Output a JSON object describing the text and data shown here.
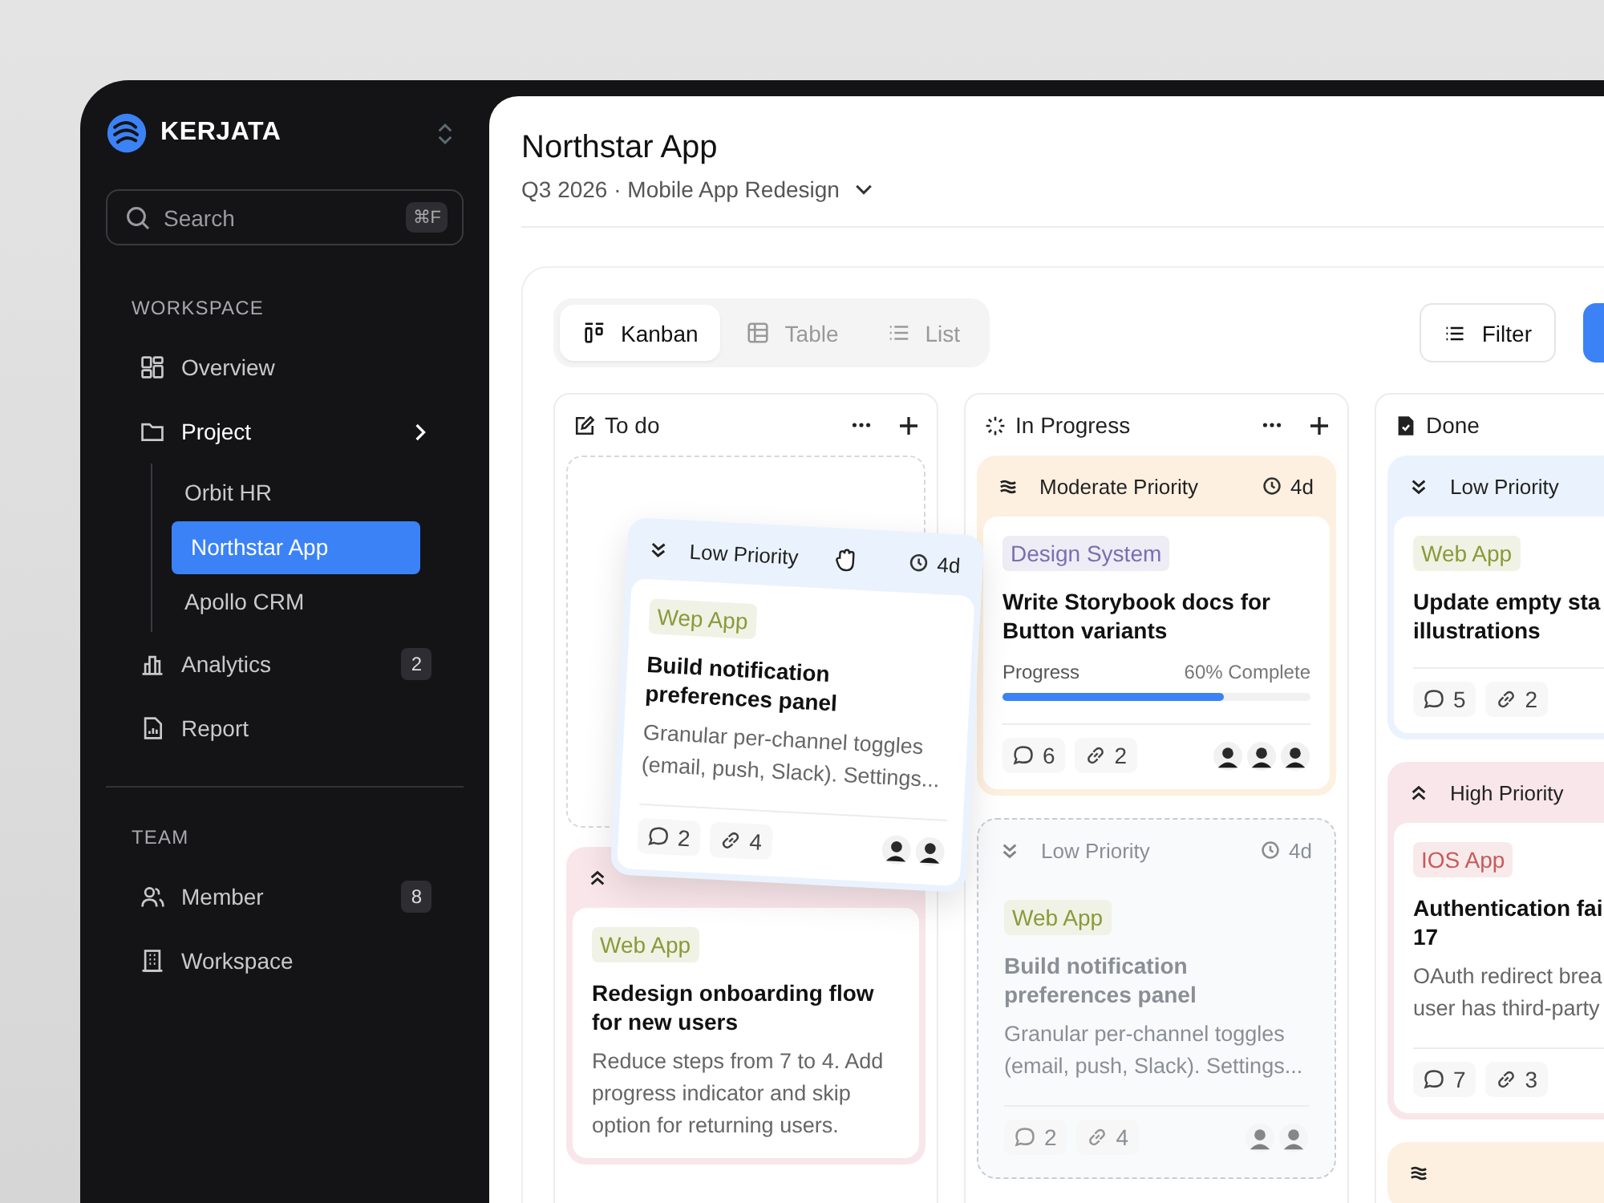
{
  "brand": {
    "name": "KERJATA"
  },
  "search": {
    "placeholder": "Search",
    "shortcut": "⌘F"
  },
  "sidebar": {
    "sections": [
      {
        "title": "WORKSPACE",
        "items": [
          {
            "label": "Overview",
            "selected": false
          },
          {
            "label": "Project",
            "selected": false,
            "children": [
              {
                "label": "Orbit HR",
                "selected": false
              },
              {
                "label": "Northstar App",
                "selected": true
              },
              {
                "label": "Apollo CRM",
                "selected": false
              }
            ]
          },
          {
            "label": "Analytics",
            "selected": false,
            "badge": "2"
          },
          {
            "label": "Report",
            "selected": false
          }
        ]
      },
      {
        "title": "TEAM",
        "items": [
          {
            "label": "Member",
            "selected": false,
            "badge": "8"
          },
          {
            "label": "Workspace",
            "selected": false
          }
        ]
      }
    ]
  },
  "header": {
    "title": "Northstar App",
    "subtitle": "Q3 2026 · Mobile App Redesign"
  },
  "view_tabs": [
    {
      "label": "Kanban",
      "selected": true
    },
    {
      "label": "Table",
      "selected": false
    },
    {
      "label": "List",
      "selected": false
    }
  ],
  "filter_button": {
    "label": "Filter"
  },
  "columns": [
    {
      "title": "To do",
      "cards": [
        {
          "kind": "placeholder"
        },
        {
          "kind": "low",
          "color": "#eaf3fd",
          "dragging": true,
          "ghost": false,
          "priority": "Low Priority",
          "due": "4d",
          "tag": {
            "label": "Wep App",
            "color": "#8a9a3a"
          },
          "title": "Build notification preferences panel",
          "description": "Granular per-channel toggles (email, push, Slack). Settings...",
          "comments": "2",
          "links": "4",
          "avatars": [
            {
              "kind": "person"
            },
            {
              "kind": "person"
            }
          ]
        },
        {
          "kind": "high",
          "color": "#f9e6ea",
          "dragging": false,
          "ghost": false,
          "tag": {
            "label": "Web App",
            "color": "#8a9a3a"
          },
          "title": "Redesign onboarding flow for new users",
          "description": "Reduce steps from 7 to 4. Add progress indicator and skip option for returning users."
        }
      ]
    },
    {
      "title": "In Progress",
      "cards": [
        {
          "kind": "moderate",
          "color": "#fdf0e0",
          "dragging": false,
          "ghost": false,
          "priority": "Moderate Priority",
          "due": "4d",
          "tag": {
            "label": "Design System",
            "color": "#7a6fb0"
          },
          "title": "Write Storybook docs for Button variants",
          "progress": {
            "label": "Progress",
            "reading": "60% Complete",
            "level": 0.72
          },
          "comments": "6",
          "links": "2",
          "avatars": [
            {
              "kind": "person"
            },
            {
              "kind": "person"
            },
            {
              "kind": "person"
            }
          ]
        },
        {
          "kind": "low",
          "color": "#eaf3fd",
          "dragging": false,
          "ghost": true,
          "priority": "Low Priority",
          "due": "4d",
          "tag": {
            "label": "Web App",
            "color": "#8a9a3a"
          },
          "title": "Build notification preferences panel",
          "description": "Granular per-channel toggles (email, push, Slack). Settings...",
          "comments": "2",
          "links": "4",
          "avatars": [
            {
              "kind": "person"
            },
            {
              "kind": "person"
            }
          ]
        }
      ]
    },
    {
      "title": "Done",
      "cards": [
        {
          "kind": "low",
          "color": "#eaf3fd",
          "dragging": false,
          "ghost": false,
          "priority": "Low Priority",
          "tag": {
            "label": "Web App",
            "color": "#8a9a3a"
          },
          "title": "Update empty sta\nillustrations",
          "comments": "5",
          "links": "2"
        },
        {
          "kind": "high",
          "color": "#f9e6ea",
          "dragging": false,
          "ghost": false,
          "priority": "High Priority",
          "tag": {
            "label": "IOS App",
            "color": "#c85a5a"
          },
          "title": "Authentication fai\n17",
          "description": "OAuth redirect brea\nuser has third-party",
          "comments": "7",
          "links": "3"
        },
        {
          "kind": "moderate",
          "color": "#fdf0e0",
          "dragging": false,
          "ghost": false
        }
      ]
    }
  ]
}
